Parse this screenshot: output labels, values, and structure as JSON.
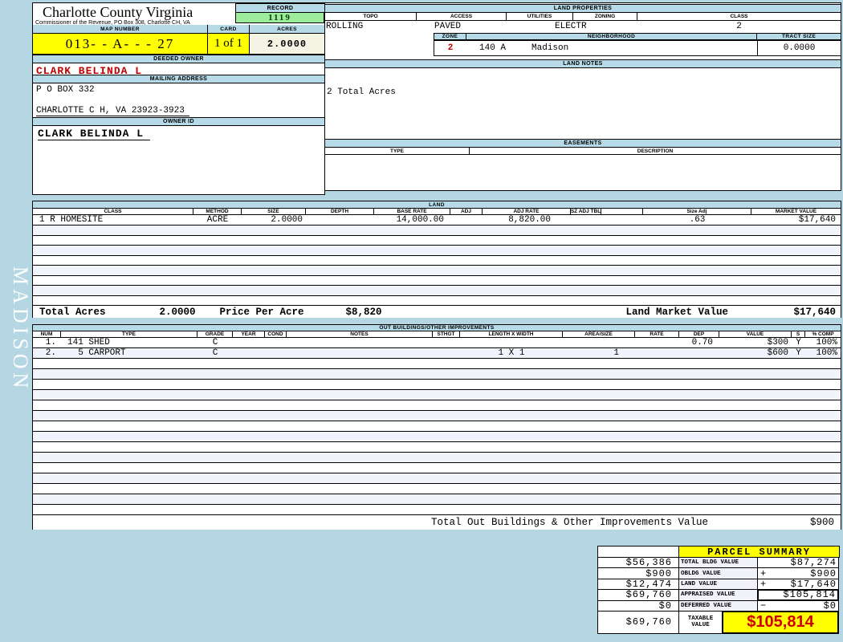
{
  "colors": {
    "page_bg": "#b4d7e3",
    "bar_bg": "#b6dae8",
    "highlight_yellow": "#ffff00",
    "record_green": "#9cec9c",
    "acres_ivory": "#f4f3e4",
    "stripe": "#f2f4fb",
    "alert_red": "#c00000"
  },
  "sidebar": {
    "vertical_label": "MADISON"
  },
  "header": {
    "county_title": "Charlotte County Virginia",
    "county_subtitle": "Commissioner of the Revenue, PO Box 308, Charlotte CH, VA",
    "record_label": "RECORD",
    "record_value": "1119",
    "map_number_label": "MAP NUMBER",
    "map_number": "013- - A-  -  - 27",
    "card_label": "CARD",
    "card_value": "1 of 1",
    "acres_label": "ACRES",
    "acres_value": "2.0000"
  },
  "owner": {
    "deeded_owner_label": "DEEDED OWNER",
    "deeded_owner": "CLARK BELINDA L",
    "mailing_address_label": "MAILING ADDRESS",
    "address_line1": "P O BOX 332",
    "address_line2": "CHARLOTTE C H, VA 23923-3923",
    "owner_id_label": "OWNER ID",
    "owner_id": "CLARK BELINDA L"
  },
  "land_properties": {
    "title": "LAND PROPERTIES",
    "topo_label": "TOPO",
    "topo": "ROLLING",
    "access_label": "ACCESS",
    "access": "PAVED",
    "utilities_label": "UTILITIES",
    "utilities": "ELECTR",
    "zoning_label": "ZONING",
    "zoning": "",
    "class_label": "CLASS",
    "class": "2",
    "zone_label": "ZONE",
    "zone": "2",
    "neighborhood_label": "NEIGHBORHOOD",
    "neighborhood_code": "140 A",
    "neighborhood_name": "Madison",
    "tract_size_label": "TRACT SIZE",
    "tract_size": "0.0000"
  },
  "land_notes": {
    "title": "LAND NOTES",
    "note": "2 Total Acres"
  },
  "easements": {
    "title": "EASEMENTS",
    "type_label": "TYPE",
    "description_label": "DESCRIPTION"
  },
  "land": {
    "title": "LAND",
    "headers": [
      "CLASS",
      "METHOD",
      "SIZE",
      "DEPTH",
      "BASE RATE",
      "ADJ",
      "ADJ RATE",
      "SZ ADJ TBL",
      "",
      "Size Adj",
      "MARKET VALUE"
    ],
    "rows": [
      [
        "1 R HOMESITE",
        "ACRE",
        "2.0000",
        "",
        "14,000.00",
        "",
        "8,820.00",
        "",
        "",
        ".63",
        "$17,640"
      ]
    ],
    "empty_row_count": 8,
    "totals": {
      "total_acres_label": "Total Acres",
      "total_acres": "2.0000",
      "price_per_acre_label": "Price Per Acre",
      "price_per_acre": "$8,820",
      "land_market_value_label": "Land Market Value",
      "land_market_value": "$17,640"
    }
  },
  "out_buildings": {
    "title": "OUT BUILDINGS/OTHER IMPROVEMENTS",
    "headers": [
      "NUM",
      "TYPE",
      "GRADE",
      "YEAR",
      "COND",
      "NOTES",
      "STHGT",
      "LENGTH X WIDTH",
      "AREA/SIZE",
      "RATE",
      "DEP",
      "VALUE",
      "S",
      "% COMP"
    ],
    "rows": [
      [
        "1.",
        "141 SHED",
        "C",
        "",
        "",
        "",
        "",
        "",
        "",
        "",
        "0.70",
        "$300",
        "Y",
        "100%"
      ],
      [
        "2.",
        "  5 CARPORT",
        "C",
        "",
        "",
        "",
        "",
        "1 X 1",
        "1",
        "",
        "",
        "$600",
        "Y",
        "100%"
      ]
    ],
    "empty_row_count": 15,
    "total_label": "Total Out Buildings & Other Improvements Value",
    "total_value": "$900"
  },
  "parcel_summary": {
    "title": "PARCEL SUMMARY",
    "rows": [
      {
        "left": "$56,386",
        "label": "TOTAL BLDG VALUE",
        "sign": "",
        "value": "$87,274",
        "boxed": false
      },
      {
        "left": "$900",
        "label": "OBLDG VALUE",
        "sign": "+",
        "value": "$900",
        "boxed": false
      },
      {
        "left": "$12,474",
        "label": "LAND VALUE",
        "sign": "+",
        "value": "$17,640",
        "boxed": false
      },
      {
        "left": "$69,760",
        "label": "APPRAISED VALUE",
        "sign": "",
        "value": "$105,814",
        "boxed": true
      },
      {
        "left": "$0",
        "label": "DEFERRED VALUE",
        "sign": "−",
        "value": "$0",
        "boxed": false
      }
    ],
    "taxable": {
      "left": "$69,760",
      "label_line1": "TAXABLE",
      "label_line2": "VALUE",
      "value": "$105,814"
    }
  }
}
